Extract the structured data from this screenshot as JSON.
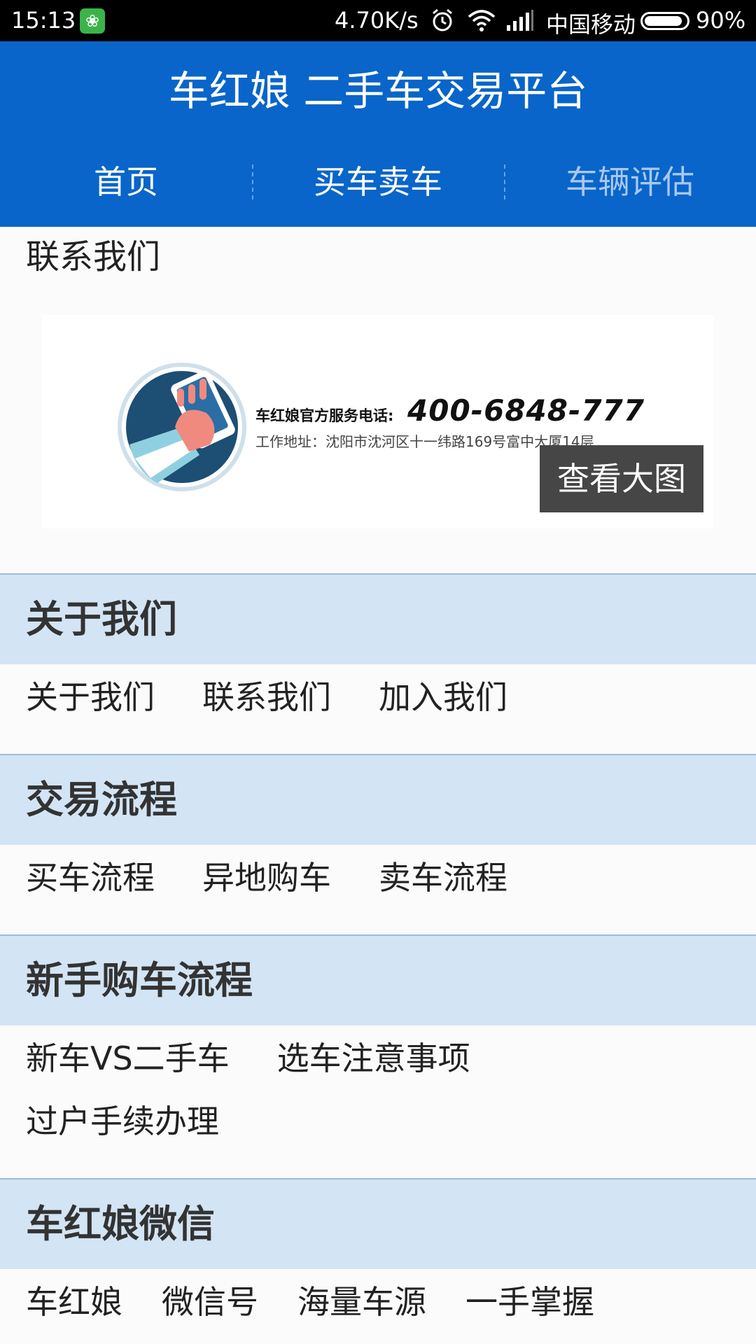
{
  "status_bar": {
    "time": "15:13",
    "app_icon": "notification-app-icon",
    "speed": "4.70K/s",
    "carrier": "中国移动",
    "battery": "90%"
  },
  "header": {
    "title": "车红娘 二手车交易平台",
    "nav": [
      "首页",
      "买车卖车",
      "车辆评估"
    ]
  },
  "contact": {
    "title": "联系我们",
    "banner": {
      "phone_label": "车红娘官方服务电话:",
      "phone": "400-6848-777",
      "address": "工作地址：沈阳市沈河区十一纬路169号富中大厦14层"
    },
    "view_large_label": "查看大图"
  },
  "sections": [
    {
      "title": "关于我们",
      "links": [
        "关于我们",
        "联系我们",
        "加入我们"
      ]
    },
    {
      "title": "交易流程",
      "links": [
        "买车流程",
        "异地购车",
        "卖车流程"
      ]
    },
    {
      "title": "新手购车流程",
      "links": [
        "新车VS二手车",
        "选车注意事项",
        "过户手续办理"
      ]
    },
    {
      "title": "车红娘微信",
      "links": [
        "车红娘",
        "微信号",
        "海量车源",
        "一手掌握"
      ]
    }
  ],
  "colors": {
    "header_blue": "#0965c9",
    "section_head_bg": "#d3e4f4",
    "nav_inactive": "#a8c8f0"
  }
}
